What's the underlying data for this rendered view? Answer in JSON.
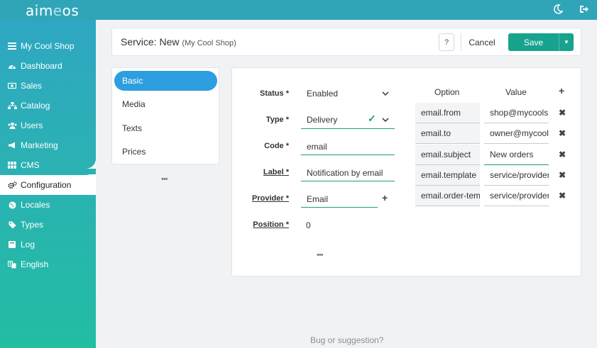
{
  "app": {
    "logo_text": "aimeos",
    "accent": "#17a38d",
    "brand": "#30a5b8"
  },
  "topbar": {
    "theme_icon": "moon-icon",
    "logout_icon": "logout-icon"
  },
  "sidebar": {
    "items": [
      {
        "label": "My Cool Shop",
        "icon": "list-icon"
      },
      {
        "label": "Dashboard",
        "icon": "dashboard-icon"
      },
      {
        "label": "Sales",
        "icon": "money-icon"
      },
      {
        "label": "Catalog",
        "icon": "sitemap-icon"
      },
      {
        "label": "Users",
        "icon": "users-icon"
      },
      {
        "label": "Marketing",
        "icon": "megaphone-icon"
      },
      {
        "label": "CMS",
        "icon": "grid-icon"
      },
      {
        "label": "Configuration",
        "icon": "cogs-icon"
      },
      {
        "label": "Locales",
        "icon": "globe-icon"
      },
      {
        "label": "Types",
        "icon": "tag-icon"
      },
      {
        "label": "Log",
        "icon": "square-icon"
      },
      {
        "label": "English",
        "icon": "language-icon"
      }
    ]
  },
  "header": {
    "title": "Service: New",
    "subtitle": "(My Cool Shop)",
    "help_label": "?",
    "cancel_label": "Cancel",
    "save_label": "Save"
  },
  "tabs": [
    {
      "label": "Basic"
    },
    {
      "label": "Media"
    },
    {
      "label": "Texts"
    },
    {
      "label": "Prices"
    }
  ],
  "form": {
    "status": {
      "label": "Status *",
      "value": "Enabled"
    },
    "type": {
      "label": "Type *",
      "value": "Delivery"
    },
    "code": {
      "label": "Code *",
      "value": "email"
    },
    "label": {
      "label": "Label *",
      "value": "Notification by email"
    },
    "provider": {
      "label": "Provider *",
      "value": "Email"
    },
    "position": {
      "label": "Position *",
      "value": "0"
    }
  },
  "config": {
    "option_header": "Option",
    "value_header": "Value",
    "rows": [
      {
        "option": "email.from",
        "value": "shop@mycoolshop"
      },
      {
        "option": "email.to",
        "value": "owner@mycoolshop"
      },
      {
        "option": "email.subject",
        "value": "New orders"
      },
      {
        "option": "email.template",
        "value": "service/provider"
      },
      {
        "option": "email.order-template",
        "value": "service/provider"
      }
    ]
  },
  "footer": {
    "text": "Bug or suggestion?"
  }
}
